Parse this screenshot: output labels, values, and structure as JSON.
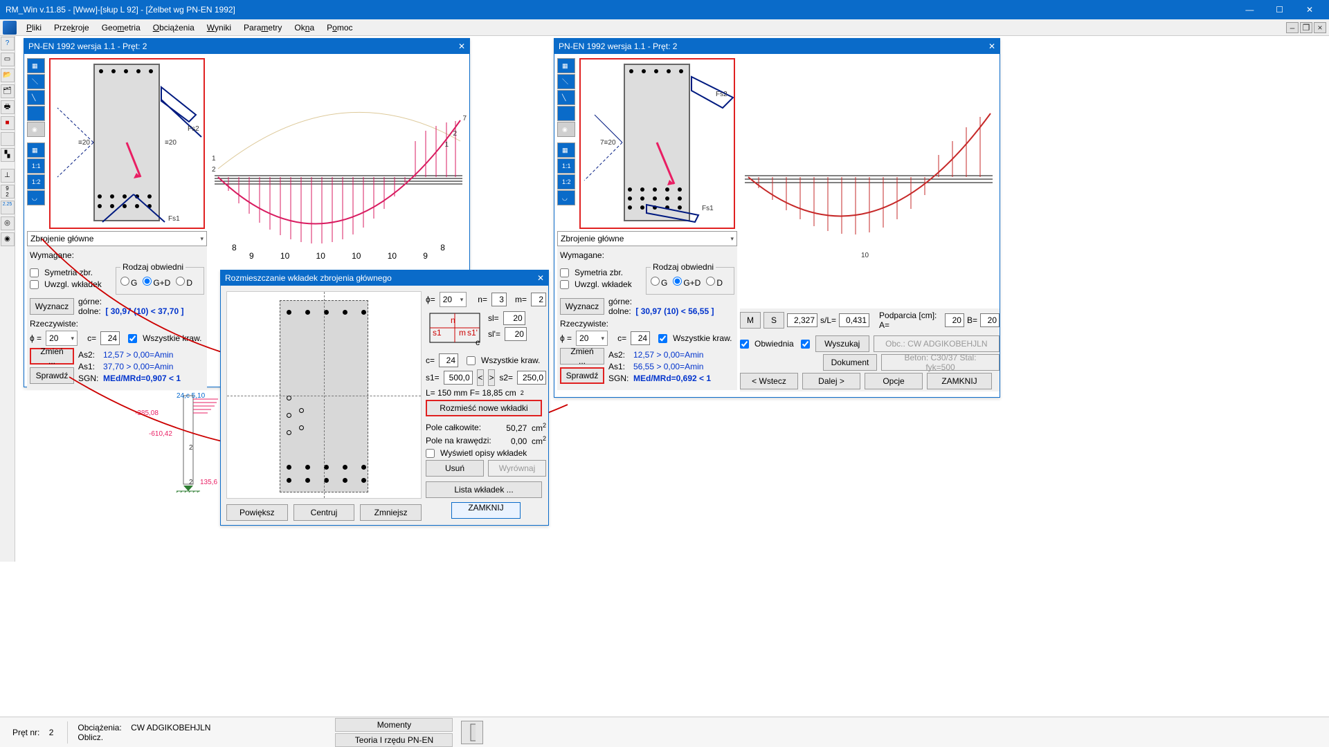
{
  "app": {
    "title": "RM_Win v.11.85 - [Www]-[słup L 92] - [Żelbet wg PN-EN 1992]"
  },
  "menu": {
    "items": [
      "Pliki",
      "Przekroje",
      "Geometria",
      "Obciążenia",
      "Wyniki",
      "Parametry",
      "Okna",
      "Pomoc"
    ]
  },
  "win_title": "PN-EN 1992 wersja 1.1 - Pręt: 2",
  "panelL": {
    "section_title": "Zbrojenie główne",
    "wymagane": "Wymagane:",
    "sym": "Symetria zbr.",
    "uwzgl": "Uwzgl. wkładek",
    "rodzaj": "Rodzaj obwiedni",
    "g": "G",
    "gd": "G+D",
    "d": "D",
    "wyznacz": "Wyznacz",
    "gorne": "górne:",
    "dolne": "dolne:",
    "dolne_val": "[ 30,97 (10) < 37,70 ]",
    "rzecz": "Rzeczywiste:",
    "phi": "ϕ  =",
    "phi_val": "20",
    "c": "c=",
    "c_val": "24",
    "allk": "Wszystkie kraw.",
    "zmien": "Zmień ...",
    "sprawdz": "Sprawdź",
    "as2": "As2:",
    "as2v": "12,57 > 0,00=Amin",
    "as1": "As1:",
    "as1v": "37,70 > 0,00=Amin",
    "sgn": "SGN:",
    "sgnv": "MEd/MRd=0,907  <  1"
  },
  "panelR": {
    "dolne_val": "[ 30,97 (10) < 56,55 ]",
    "as2v": "12,57 > 0,00=Amin",
    "as1v": "56,55 > 0,00=Amin",
    "sgnv": "MEd/MRd=0,692  <  1",
    "M": "M",
    "S": "S",
    "s_val": "2,327",
    "sl": "s/L=",
    "sl_val": "0,431",
    "podp": "Podparcia [cm]:  A=",
    "a_val": "20",
    "b_lbl": "B=",
    "b_val": "20",
    "obwiednia": "Obwiednia",
    "wyszukaj": "Wyszukaj",
    "obc": "Obc.: CW ADGIKOBEHJLN",
    "dokument": "Dokument",
    "beton": "Beton: C30/37   Stal: fyk=500",
    "wstecz": "< Wstecz",
    "dalej": "Dalej >",
    "opcje": "Opcje",
    "zamknij": "ZAMKNIJ"
  },
  "dlg": {
    "title": "Rozmieszczanie wkładek zbrojenia głównego",
    "phi": "ϕ=",
    "phi_v": "20",
    "n": "n=",
    "n_v": "3",
    "m": "m=",
    "m_v": "2",
    "sl": "sl=",
    "sl_v": "20",
    "slp": "sl'=",
    "slp_v": "20",
    "c": "c=",
    "c_v": "24",
    "allk": "Wszystkie kraw.",
    "s1": "s1=",
    "s1_v": "500,0",
    "lt": "<",
    "gt": ">",
    "s2": "s2=",
    "s2_v": "250,0",
    "L": "L=  150    mm     F=       18,85 cm",
    "rozm": "Rozmieść nowe wkładki",
    "pole_c": "Pole całkowite:",
    "pole_c_v": "50,27",
    "cm2": "cm",
    "pole_k": "Pole na krawędzi:",
    "pole_k_v": "0,00",
    "wysw": "Wyświetl opisy wkładek",
    "usun": "Usuń",
    "wyrownaj": "Wyrównaj",
    "lista": "Lista wkładek ...",
    "zamknij": "ZAMKNIJ",
    "powieksz": "Powiększ",
    "centruj": "Centruj",
    "zmniejsz": "Zmniejsz"
  },
  "annotations": {
    "lbl_20_l": "≡20",
    "lbl_20_r": "≡20",
    "fs1": "Fs1",
    "fs2": "Fs2",
    "seven": "7≡20",
    "val_385": "-385,08",
    "val_610": "-610,42",
    "val_24c": "24,c  5,10",
    "val_135": "135,6",
    "n2a": "2",
    "n2b": "2",
    "n10": "10"
  },
  "status": {
    "pret": "Pręt nr:",
    "pret_v": "2",
    "obc": "Obciążenia:",
    "obc_v": "CW ADGIKOBEHJLN",
    "oblicz": "Oblicz.",
    "mom": "Momenty",
    "teoria": "Teoria I rzędu PN-EN"
  }
}
